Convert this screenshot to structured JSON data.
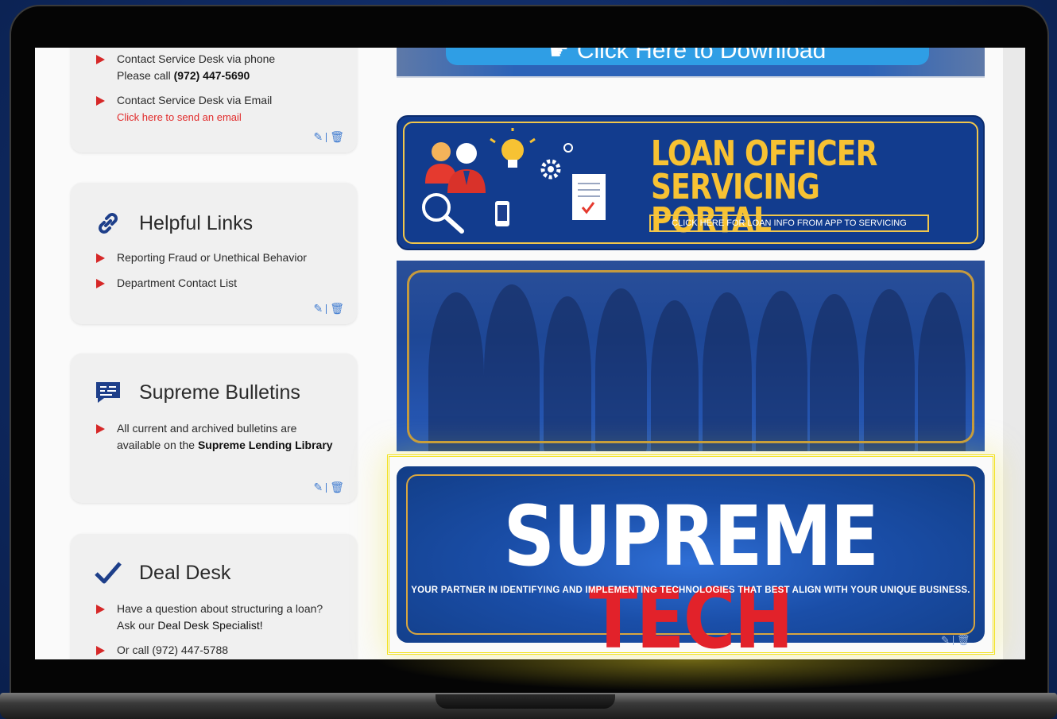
{
  "contact_card": {
    "bullets": [
      {
        "line1": "Contact Service Desk via phone",
        "line2_prefix": "Please call ",
        "line2_bold": "(972) 447-5690"
      },
      {
        "line1": "Contact Service Desk via Email",
        "link": "Click here to send an email"
      }
    ]
  },
  "helpful_links": {
    "title": "Helpful Links",
    "icon": "link-icon",
    "items": [
      "Reporting Fraud or Unethical Behavior",
      "Department Contact List"
    ]
  },
  "bulletins": {
    "title": "Supreme Bulletins",
    "icon": "chat-icon",
    "text": "All current and archived bulletins are available on the ",
    "bold": "Supreme Lending Library"
  },
  "deal_desk": {
    "title": "Deal Desk",
    "icon": "checkmark-icon",
    "item1_text": "Have a question about structuring a loan? Ask our ",
    "item1_bold": "Deal Desk Specialist!",
    "item2": "Or call (972) 447-5788"
  },
  "banners": {
    "download_label": "Click Here to Download",
    "loan_title_line1": "LOAN OFFICER",
    "loan_title_line2": "SERVICING PORTAL",
    "loan_subtitle": "CLICK HERE FOR LOAN INFO FROM APP TO SERVICING",
    "tech_title_white": "SUPREME ",
    "tech_title_red": "TECH",
    "tech_subtitle": "YOUR PARTNER IN IDENTIFYING AND IMPLEMENTING TECHNOLOGIES THAT BEST ALIGN WITH YOUR UNIQUE BUSINESS."
  },
  "colors": {
    "accent_red": "#e2222a",
    "navy": "#123c8e",
    "gold": "#f7c233",
    "highlight": "#f2e21b"
  }
}
